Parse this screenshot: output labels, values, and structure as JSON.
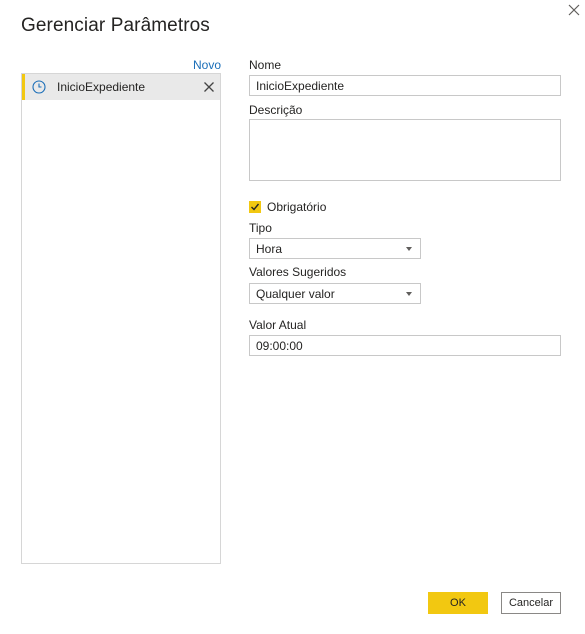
{
  "dialog": {
    "title": "Gerenciar Parâmetros",
    "close_icon": "close-icon"
  },
  "sidebar": {
    "new_link": "Novo",
    "items": [
      {
        "label": "InicioExpediente",
        "icon": "clock-icon",
        "selected": true
      }
    ]
  },
  "form": {
    "name_label": "Nome",
    "name_value": "InicioExpediente",
    "description_label": "Descrição",
    "description_value": "",
    "required_label": "Obrigatório",
    "required_checked": true,
    "type_label": "Tipo",
    "type_value": "Hora",
    "suggested_label": "Valores Sugeridos",
    "suggested_value": "Qualquer valor",
    "current_label": "Valor Atual",
    "current_value": "09:00:00"
  },
  "footer": {
    "ok_label": "OK",
    "cancel_label": "Cancelar"
  },
  "colors": {
    "accent": "#f2c811",
    "link": "#1a6eb8",
    "selected_bg": "#e9e9e9"
  }
}
